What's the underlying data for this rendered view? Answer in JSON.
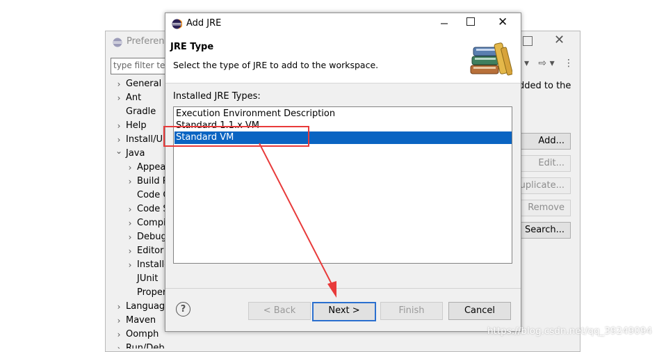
{
  "preferences": {
    "title": "Preferenc",
    "filter_placeholder": "type filter tex",
    "description": "dded to the",
    "tree": [
      {
        "label": "General",
        "indent": 0,
        "chevron": "right"
      },
      {
        "label": "Ant",
        "indent": 0,
        "chevron": "right"
      },
      {
        "label": "Gradle",
        "indent": 0,
        "chevron": "none"
      },
      {
        "label": "Help",
        "indent": 0,
        "chevron": "right"
      },
      {
        "label": "Install/Up",
        "indent": 0,
        "chevron": "right"
      },
      {
        "label": "Java",
        "indent": 0,
        "chevron": "down"
      },
      {
        "label": "Appear",
        "indent": 1,
        "chevron": "right"
      },
      {
        "label": "Build P",
        "indent": 1,
        "chevron": "right"
      },
      {
        "label": "Code C",
        "indent": 1,
        "chevron": "none"
      },
      {
        "label": "Code S",
        "indent": 1,
        "chevron": "right"
      },
      {
        "label": "Compil",
        "indent": 1,
        "chevron": "right"
      },
      {
        "label": "Debug",
        "indent": 1,
        "chevron": "right"
      },
      {
        "label": "Editor",
        "indent": 1,
        "chevron": "right"
      },
      {
        "label": "Installe",
        "indent": 1,
        "chevron": "right",
        "selected": true
      },
      {
        "label": "JUnit",
        "indent": 1,
        "chevron": "none"
      },
      {
        "label": "Proper",
        "indent": 1,
        "chevron": "none"
      },
      {
        "label": "Language",
        "indent": 0,
        "chevron": "right"
      },
      {
        "label": "Maven",
        "indent": 0,
        "chevron": "right"
      },
      {
        "label": "Oomph",
        "indent": 0,
        "chevron": "right"
      },
      {
        "label": "Run/Deb",
        "indent": 0,
        "chevron": "right"
      }
    ],
    "side_buttons": [
      {
        "label": "Add...",
        "enabled": true
      },
      {
        "label": "Edit...",
        "enabled": false
      },
      {
        "label": "Duplicate...",
        "enabled": false
      },
      {
        "label": "Remove",
        "enabled": false
      },
      {
        "label": "Search...",
        "enabled": true
      }
    ]
  },
  "dialog": {
    "title": "Add JRE",
    "banner_title": "JRE Type",
    "banner_description": "Select the type of JRE to add to the workspace.",
    "list_label": "Installed JRE Types:",
    "jre_types": [
      {
        "label": "Execution Environment Description",
        "selected": false
      },
      {
        "label": "Standard 1.1.x VM",
        "selected": false
      },
      {
        "label": "Standard VM",
        "selected": true
      }
    ],
    "buttons": {
      "back": "< Back",
      "next": "Next >",
      "finish": "Finish",
      "cancel": "Cancel"
    },
    "help_glyph": "?"
  },
  "annotation": {
    "color": "#e83a3a"
  },
  "watermark": "https://blog.csdn.net/qq_39249094",
  "colors": {
    "selection": "#0a64c2",
    "dialog_bg": "#f0f0f0",
    "default_button_border": "#2a6fcf"
  },
  "icons": [
    "eclipse-icon",
    "books-icon",
    "help-icon",
    "close-icon",
    "maximize-icon",
    "minimize-icon"
  ]
}
